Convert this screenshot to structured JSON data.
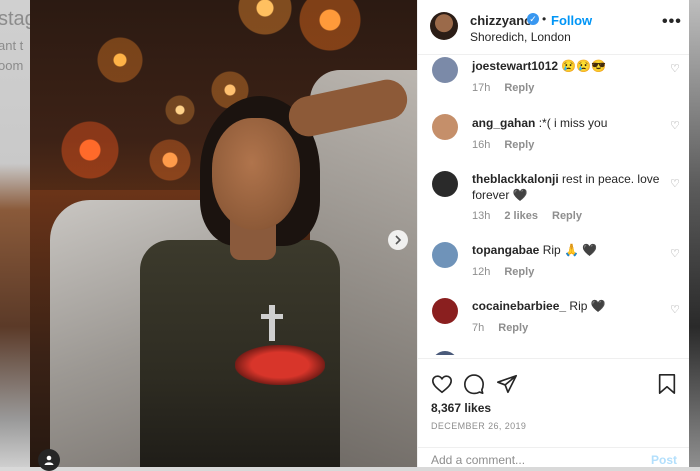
{
  "background": {
    "left_fragment_lines": [
      "stag",
      "ant t",
      "oom"
    ]
  },
  "post": {
    "username": "chizzyano",
    "verified_icon": "verified-badge-icon",
    "separator": "•",
    "follow_label": "Follow",
    "location": "Shoredich, London",
    "more_label": "•••",
    "likes": "8,367 likes",
    "date": "DECEMBER 26, 2019",
    "add_comment_placeholder": "Add a comment...",
    "post_label": "Post"
  },
  "comments": [
    {
      "user": "joestewart1012",
      "text": "😢😢😎",
      "time": "17h",
      "likes": "",
      "reply": "Reply",
      "avatar_color": "#7b8aa8"
    },
    {
      "user": "ang_gahan",
      "text": ":*( i miss you",
      "time": "16h",
      "likes": "",
      "reply": "Reply",
      "avatar_color": "#c58f6a"
    },
    {
      "user": "theblackkalonji",
      "text": "rest in peace. love forever 🖤",
      "time": "13h",
      "likes": "2 likes",
      "reply": "Reply",
      "avatar_color": "#2a2a2a"
    },
    {
      "user": "topangabae",
      "text": "Rip 🙏 🖤",
      "time": "12h",
      "likes": "",
      "reply": "Reply",
      "avatar_color": "#6f93b9"
    },
    {
      "user": "cocainebarbiee_",
      "text": "Rip 🖤",
      "time": "7h",
      "likes": "",
      "reply": "Reply",
      "avatar_color": "#8a1f1f"
    }
  ],
  "colors": {
    "accent": "#0095f6",
    "verified": "#3897f0",
    "muted": "#8e8e8e",
    "post_disabled": "#b2dffc"
  },
  "icons": {
    "like": "heart-icon",
    "comment": "comment-icon",
    "share": "share-icon",
    "save": "bookmark-icon",
    "comment_like": "heart-outline-icon",
    "carousel_next": "chevron-right-icon",
    "tagged_users": "user-tag-icon"
  }
}
